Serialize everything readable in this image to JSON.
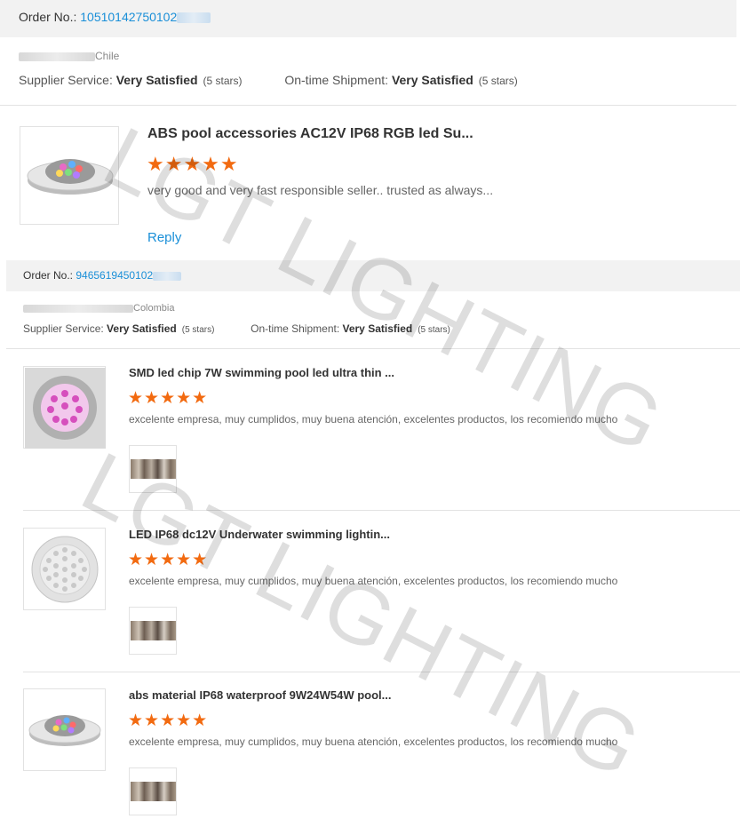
{
  "review1": {
    "order_label": "Order No.: ",
    "order_number": "10510142750102",
    "buyer_country": "Chile",
    "supplier_label": "Supplier Service: ",
    "supplier_value": "Very Satisfied",
    "supplier_stars": "(5 stars)",
    "shipment_label": "On-time Shipment: ",
    "shipment_value": "Very Satisfied",
    "shipment_stars": "(5 stars)",
    "product_title": "ABS pool accessories AC12V IP68 RGB led Su...",
    "stars": "★★★★★",
    "comment": "very good and very fast responsible seller.. trusted as always...",
    "reply_label": "Reply"
  },
  "review2": {
    "order_label": "Order No.: ",
    "order_number": "9465619450102",
    "buyer_country": "Colombia",
    "supplier_label": "Supplier Service: ",
    "supplier_value": "Very Satisfied",
    "supplier_stars": "(5 stars)",
    "shipment_label": "On-time Shipment: ",
    "shipment_value": "Very Satisfied",
    "shipment_stars": "(5 stars)",
    "items": [
      {
        "title": "SMD led chip 7W swimming pool led ultra thin ...",
        "stars": "★★★★★",
        "comment": "excelente empresa, muy cumplidos, muy buena atención, excelentes productos, los recomiendo mucho"
      },
      {
        "title": "LED IP68 dc12V Underwater swimming lightin...",
        "stars": "★★★★★",
        "comment": "excelente empresa, muy cumplidos, muy buena atención, excelentes productos, los recomiendo mucho"
      },
      {
        "title": "abs material IP68 waterproof 9W24W54W pool...",
        "stars": "★★★★★",
        "comment": "excelente empresa, muy cumplidos, muy buena atención, excelentes productos, los recomiendo mucho"
      }
    ]
  },
  "watermark": "LGT LIGHTING",
  "colors": {
    "link": "#1a8fd8",
    "star": "#f26a10",
    "bar": "#f2f2f2"
  }
}
